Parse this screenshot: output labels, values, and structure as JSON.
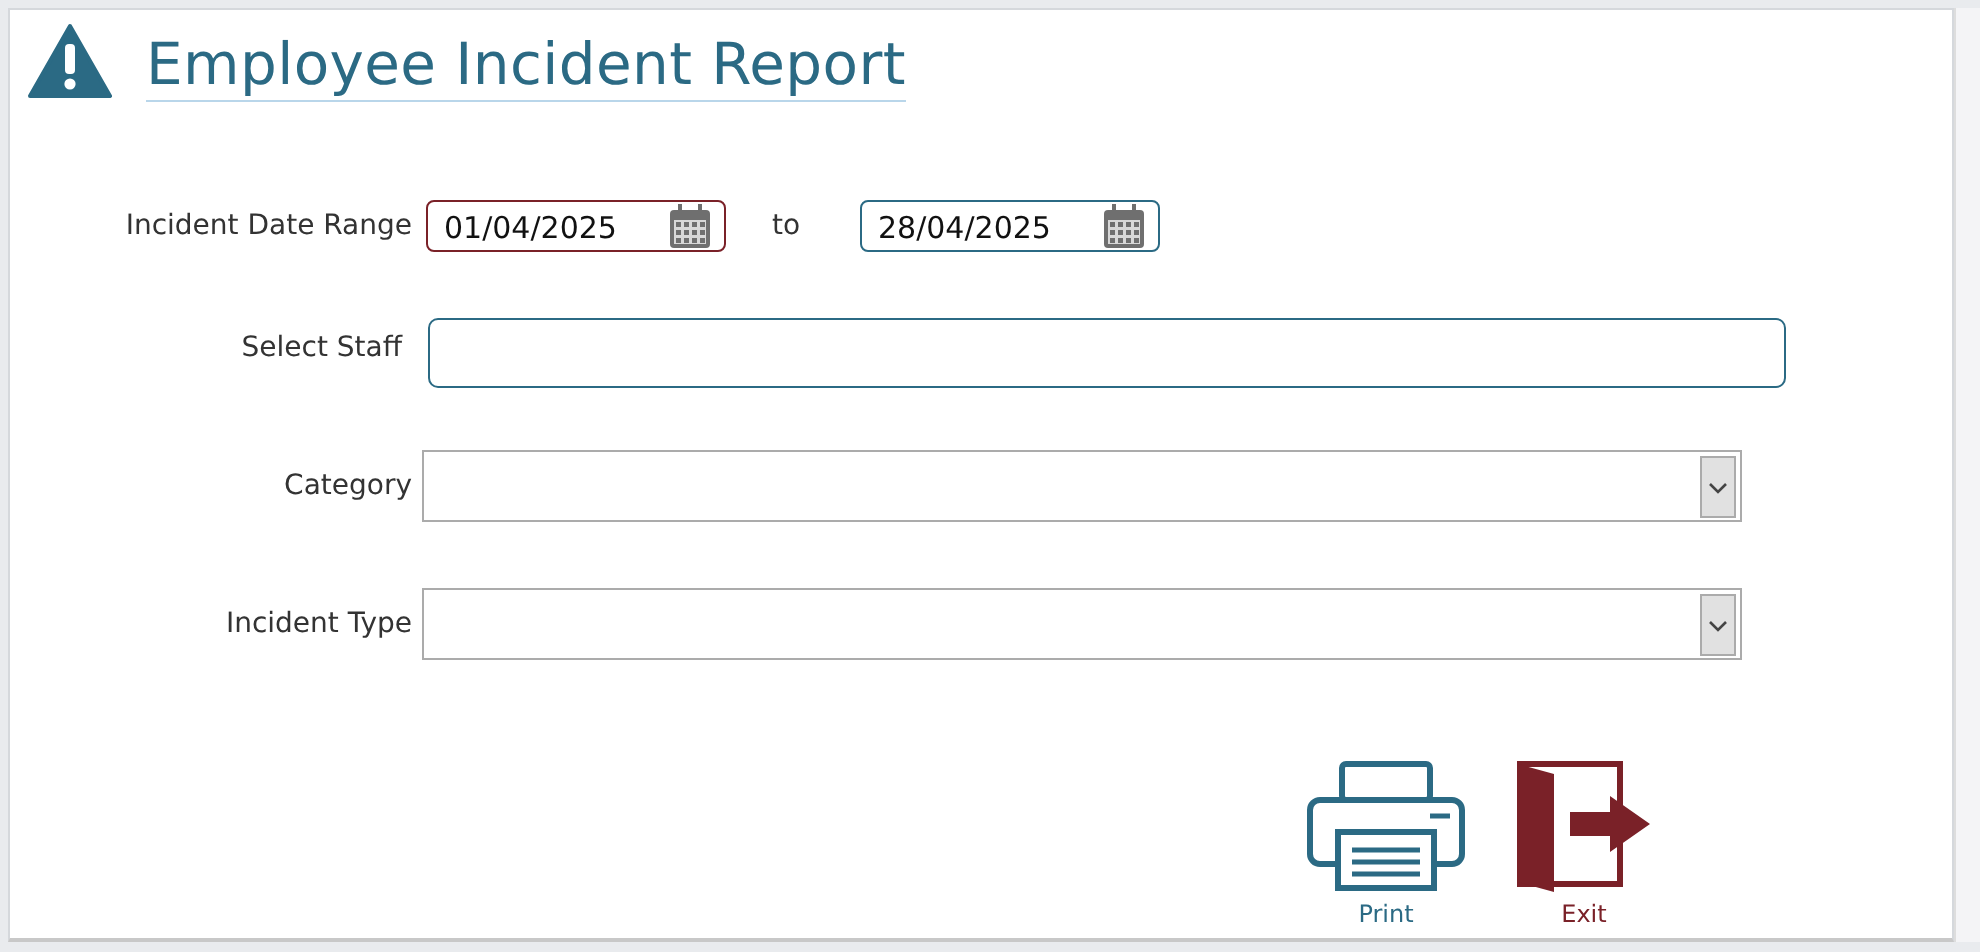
{
  "header": {
    "title": "Employee Incident Report"
  },
  "date_range": {
    "label": "Incident Date Range",
    "separator": "to",
    "fields": [
      {
        "value": "01/04/2025",
        "invalid": true
      },
      {
        "value": "28/04/2025",
        "invalid": false
      }
    ]
  },
  "staff": {
    "label": "Select Staff"
  },
  "dropdowns": [
    {
      "label": "Category"
    },
    {
      "label": "Incident Type"
    }
  ],
  "actions": [
    {
      "kind": "print",
      "label": "Print"
    },
    {
      "kind": "exit",
      "label": "Exit"
    }
  ]
}
